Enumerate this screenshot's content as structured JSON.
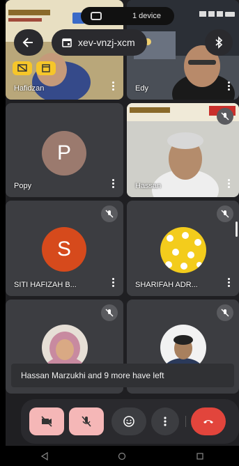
{
  "status": {
    "device_label": "1 device"
  },
  "header": {
    "meeting_code": "xev-vnzj-xcm"
  },
  "tiles": [
    {
      "name": "Hafidzan",
      "overlay_badges": [
        "screen-share-icon",
        "window-icon"
      ]
    },
    {
      "name": "Edy"
    },
    {
      "name": "Popy",
      "initial": "P",
      "avatar_color": "#9b7a6e"
    },
    {
      "name": "Hassan",
      "muted": true
    },
    {
      "name": "SITI HAFIZAH B...",
      "initial": "S",
      "avatar_color": "#d64a1c",
      "muted": true
    },
    {
      "name": "SHARIFAH ADR...",
      "muted": true
    },
    {
      "name": "",
      "muted": true
    },
    {
      "name": "",
      "muted": true
    }
  ],
  "toast": {
    "message": "Hassan Marzukhi and 9 more have left"
  },
  "colors": {
    "end_call": "#e2453c",
    "muted_control": "#f5b7b7",
    "background": "#1f1f22"
  }
}
